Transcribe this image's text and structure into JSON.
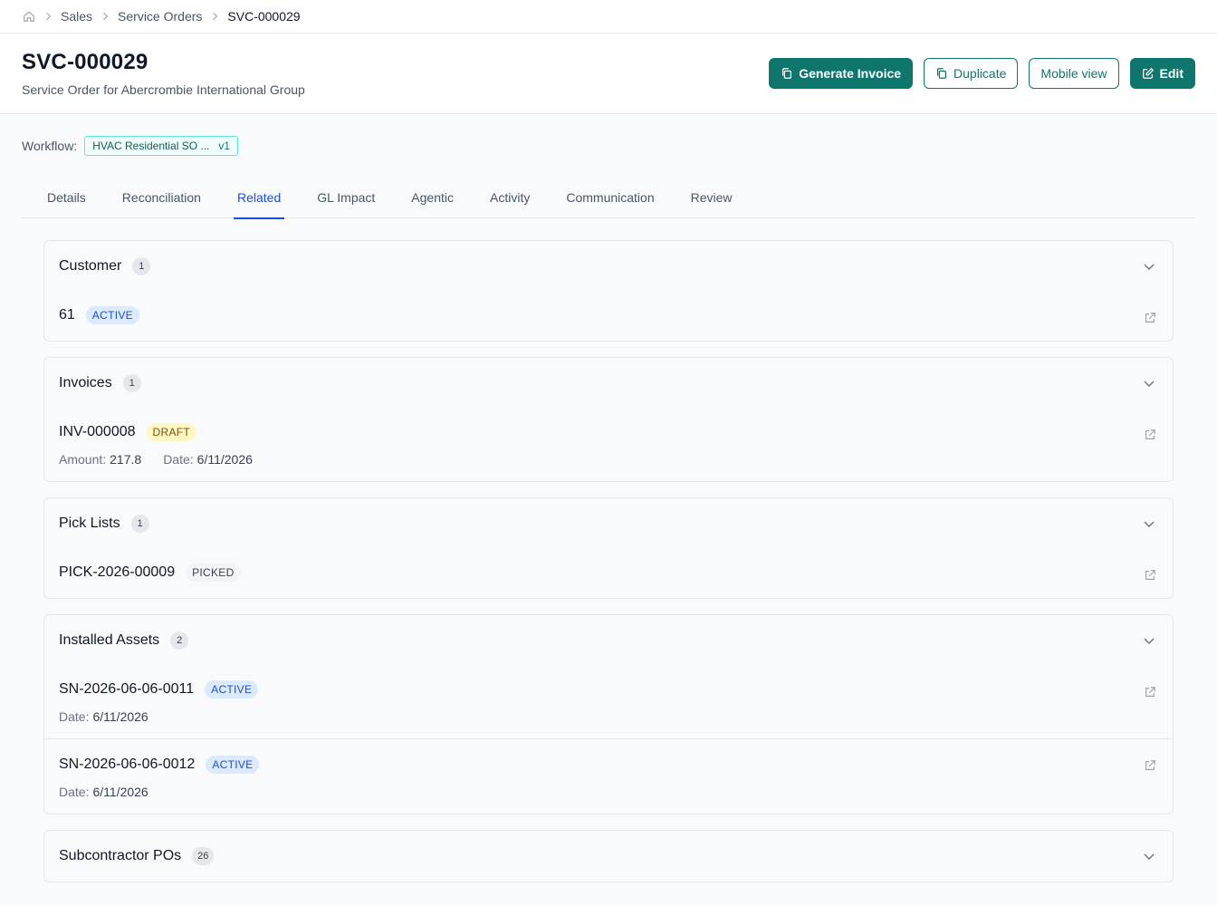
{
  "breadcrumb": {
    "items": [
      "Sales",
      "Service Orders",
      "SVC-000029"
    ]
  },
  "header": {
    "title": "SVC-000029",
    "subtitle": "Service Order for Abercrombie International Group",
    "buttons": {
      "generate_invoice": "Generate Invoice",
      "duplicate": "Duplicate",
      "mobile_view": "Mobile view",
      "edit": "Edit"
    }
  },
  "workflow": {
    "label": "Workflow:",
    "name": "HVAC Residential SO ...",
    "version": "v1"
  },
  "tabs": [
    "Details",
    "Reconciliation",
    "Related",
    "GL Impact",
    "Agentic",
    "Activity",
    "Communication",
    "Review"
  ],
  "active_tab": "Related",
  "sections": {
    "customer": {
      "title": "Customer",
      "count": "1",
      "items": [
        {
          "title": "61",
          "status": "ACTIVE"
        }
      ]
    },
    "invoices": {
      "title": "Invoices",
      "count": "1",
      "items": [
        {
          "title": "INV-000008",
          "status": "DRAFT",
          "amount_label": "Amount:",
          "amount": "217.8",
          "date_label": "Date:",
          "date": "6/11/2026"
        }
      ]
    },
    "pick_lists": {
      "title": "Pick Lists",
      "count": "1",
      "items": [
        {
          "title": "PICK-2026-00009",
          "status": "PICKED"
        }
      ]
    },
    "installed_assets": {
      "title": "Installed Assets",
      "count": "2",
      "items": [
        {
          "title": "SN-2026-06-06-0011",
          "status": "ACTIVE",
          "date_label": "Date:",
          "date": "6/11/2026"
        },
        {
          "title": "SN-2026-06-06-0012",
          "status": "ACTIVE",
          "date_label": "Date:",
          "date": "6/11/2026"
        }
      ]
    },
    "subcontractor_pos": {
      "title": "Subcontractor POs",
      "count": "26"
    }
  },
  "colors": {
    "brand": "#0f766e",
    "active_tab": "#1d4ed8",
    "badge_active_bg": "#dbeafe",
    "badge_draft_bg": "#fef9c3"
  }
}
